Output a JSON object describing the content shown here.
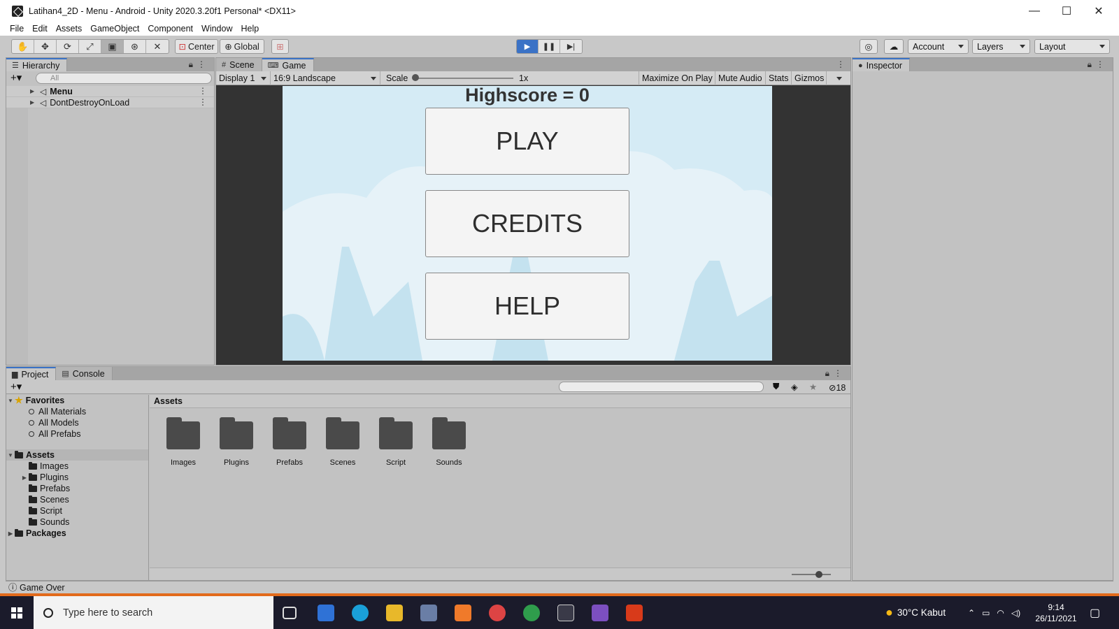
{
  "window": {
    "title": "Latihan4_2D - Menu - Android - Unity 2020.3.20f1 Personal* <DX11>",
    "minimize": "—",
    "maximize": "☐",
    "close": "✕"
  },
  "menu": [
    "File",
    "Edit",
    "Assets",
    "GameObject",
    "Component",
    "Window",
    "Help"
  ],
  "toolbar": {
    "pivot": "Center",
    "space": "Global",
    "account": "Account",
    "layers": "Layers",
    "layout": "Layout"
  },
  "hierarchy": {
    "tab": "Hierarchy",
    "search_placeholder": "All",
    "items": [
      {
        "label": "Menu"
      },
      {
        "label": "DontDestroyOnLoad"
      }
    ]
  },
  "gameview": {
    "tabs": [
      "Scene",
      "Game"
    ],
    "display": "Display 1",
    "aspect": "16:9 Landscape",
    "scale_label": "Scale",
    "scale_value": "1x",
    "maximize": "Maximize On Play",
    "mute": "Mute Audio",
    "stats": "Stats",
    "gizmos": "Gizmos",
    "highscore": "Highscore = 0",
    "buttons": [
      "PLAY",
      "CREDITS",
      "HELP"
    ]
  },
  "inspector": {
    "tab": "Inspector"
  },
  "project": {
    "tabs": [
      "Project",
      "Console"
    ],
    "hidden_count": "18",
    "favorites_label": "Favorites",
    "favorites": [
      "All Materials",
      "All Models",
      "All Prefabs"
    ],
    "assets_label": "Assets",
    "asset_folders": [
      "Images",
      "Plugins",
      "Prefabs",
      "Scenes",
      "Script",
      "Sounds"
    ],
    "packages_label": "Packages",
    "breadcrumb": "Assets"
  },
  "status": {
    "message": "Game Over"
  },
  "taskbar": {
    "search_placeholder": "Type here to search",
    "weather": "30°C  Kabut",
    "time": "9:14",
    "date": "26/11/2021"
  }
}
